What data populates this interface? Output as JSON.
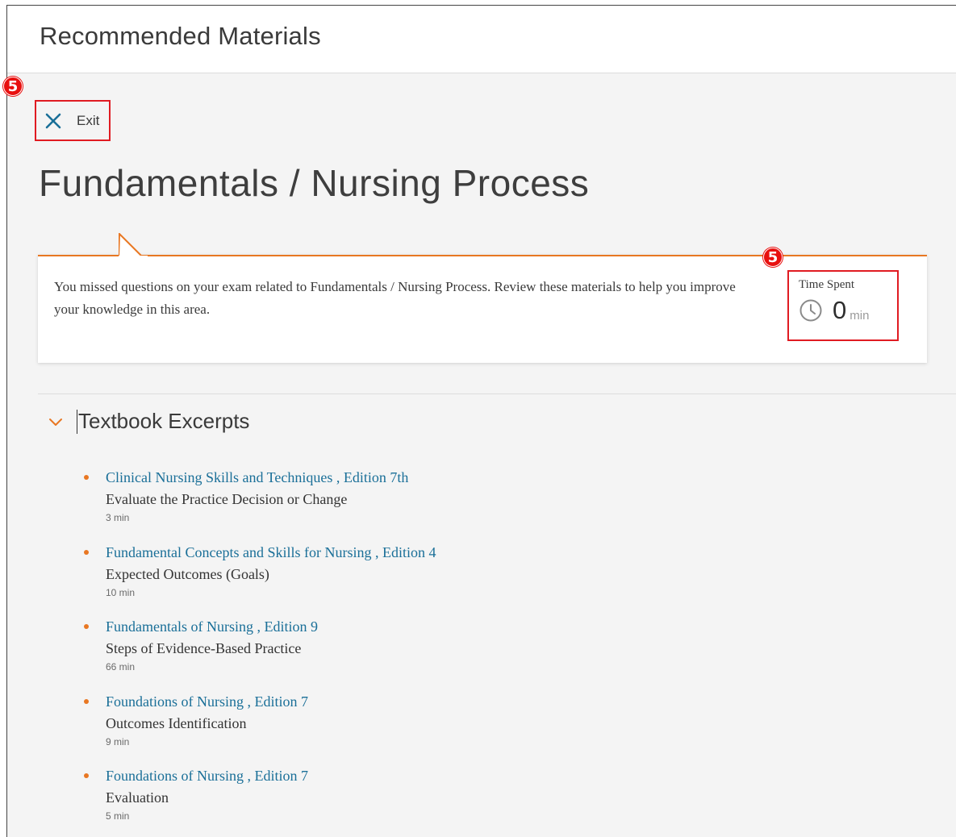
{
  "header": {
    "title": "Recommended Materials"
  },
  "annotations": {
    "exit_marker": "5",
    "time_marker": "5"
  },
  "exit": {
    "label": "Exit",
    "icon": "close-icon"
  },
  "page": {
    "title": "Fundamentals / Nursing Process"
  },
  "info": {
    "message": "You missed questions on your exam related to Fundamentals / Nursing Process. Review these materials to help you improve your knowledge in this area.",
    "time_spent": {
      "label": "Time Spent",
      "value": "0",
      "unit": "min",
      "icon": "clock-icon"
    }
  },
  "section": {
    "title": "Textbook Excerpts",
    "icon": "chevron-down-icon"
  },
  "materials": [
    {
      "book": "Clinical Nursing Skills and Techniques , Edition 7th",
      "chapter": "Evaluate the Practice Decision or Change",
      "duration": "3 min"
    },
    {
      "book": "Fundamental Concepts and Skills for Nursing , Edition 4",
      "chapter": "Expected Outcomes (Goals)",
      "duration": "10 min"
    },
    {
      "book": "Fundamentals of Nursing , Edition 9",
      "chapter": "Steps of Evidence-Based Practice",
      "duration": "66 min"
    },
    {
      "book": "Foundations of Nursing , Edition 7",
      "chapter": "Outcomes Identification",
      "duration": "9 min"
    },
    {
      "book": "Foundations of Nursing , Edition 7",
      "chapter": "Evaluation",
      "duration": "5 min"
    }
  ],
  "colors": {
    "accent": "#e87722",
    "link": "#1a6f98",
    "annotation": "#e01b22"
  }
}
